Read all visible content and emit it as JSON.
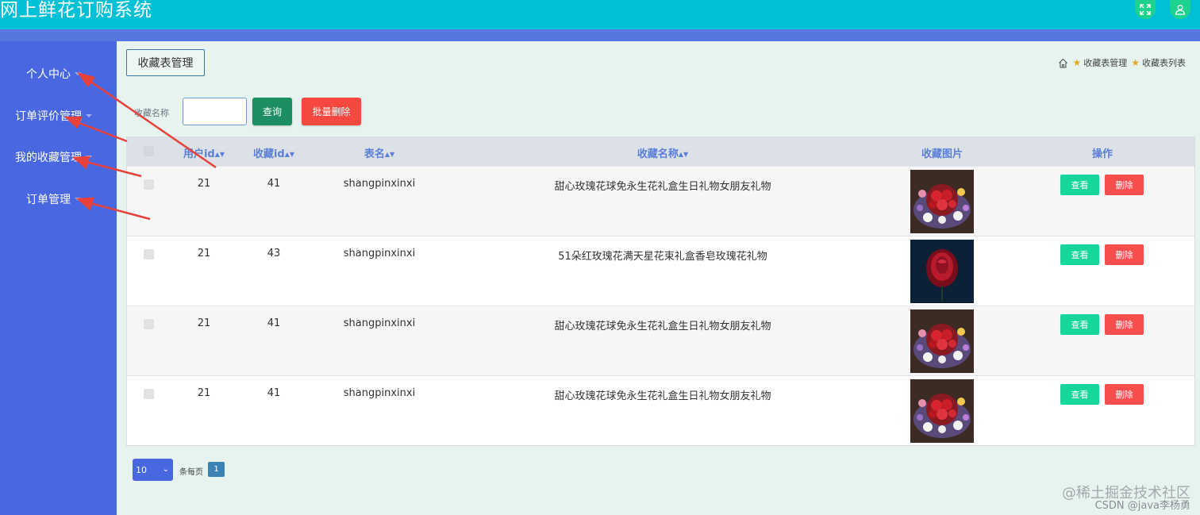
{
  "app": {
    "title": "网上鲜花订购系统"
  },
  "header_icons": [
    {
      "icon": "fullscreen-icon"
    },
    {
      "icon": "user-icon"
    }
  ],
  "sidebar": {
    "items": [
      {
        "label": "个人中心"
      },
      {
        "label": "订单评价管理"
      },
      {
        "label": "我的收藏管理"
      },
      {
        "label": "订单管理"
      }
    ]
  },
  "page": {
    "tab_label": "收藏表管理",
    "breadcrumb": [
      "收藏表管理",
      "收藏表列表"
    ]
  },
  "search": {
    "label": "收藏名称",
    "input_value": "",
    "search_button": "查询",
    "batch_delete_button": "批量删除"
  },
  "table": {
    "headers": {
      "user_id": "用户id",
      "fav_id": "收藏id",
      "table_name": "表名",
      "fav_name": "收藏名称",
      "fav_image": "收藏图片",
      "actions": "操作"
    },
    "view_label": "查看",
    "delete_label": "删除",
    "rows": [
      {
        "user_id": "21",
        "fav_id": "41",
        "table_name": "shangpinxinxi",
        "fav_name": "甜心玫瑰花球免永生花礼盒生日礼物女朋友礼物",
        "image": "flower-bouquet"
      },
      {
        "user_id": "21",
        "fav_id": "43",
        "table_name": "shangpinxinxi",
        "fav_name": "51朵红玫瑰花满天星花束礼盒香皂玫瑰花礼物",
        "image": "red-rose"
      },
      {
        "user_id": "21",
        "fav_id": "41",
        "table_name": "shangpinxinxi",
        "fav_name": "甜心玫瑰花球免永生花礼盒生日礼物女朋友礼物",
        "image": "flower-bouquet"
      },
      {
        "user_id": "21",
        "fav_id": "41",
        "table_name": "shangpinxinxi",
        "fav_name": "甜心玫瑰花球免永生花礼盒生日礼物女朋友礼物",
        "image": "flower-bouquet"
      }
    ]
  },
  "pagination": {
    "page_size": "10",
    "per_page_label": "条每页",
    "current_page": "1"
  },
  "watermark": {
    "line1": "@稀土掘金技术社区",
    "line2": "CSDN @java李杨勇"
  },
  "colors": {
    "topbar": "#00c0d6",
    "sidebar": "#4a67e2",
    "search_button": "#1d8e61",
    "delete_button": "#f64840",
    "view_button": "#17d69b"
  }
}
